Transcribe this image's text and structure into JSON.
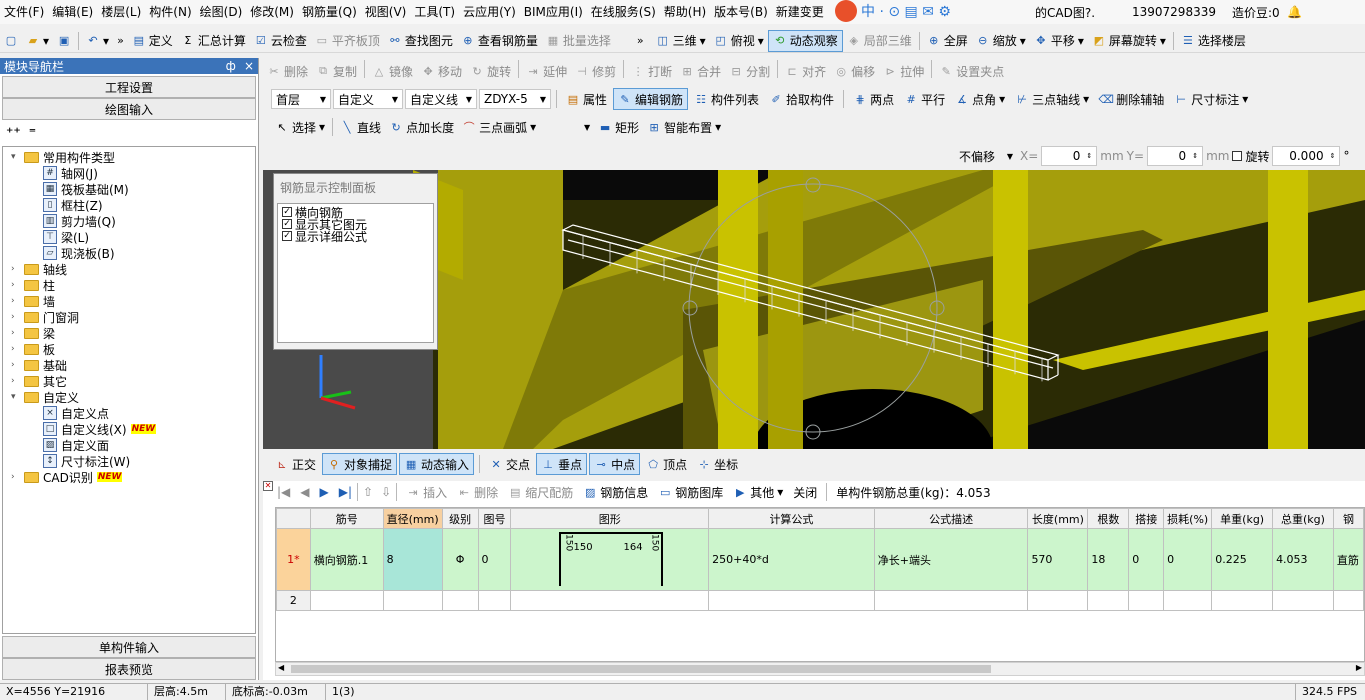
{
  "menu": [
    "文件(F)",
    "编辑(E)",
    "楼层(L)",
    "构件(N)",
    "绘图(D)",
    "修改(M)",
    "钢筋量(Q)",
    "视图(V)",
    "工具(T)",
    "云应用(Y)",
    "BIM应用(I)",
    "在线服务(S)",
    "帮助(H)",
    "版本号(B)",
    "新建变更"
  ],
  "menu_right": {
    "cad": "的CAD图?.",
    "phone": "13907298339",
    "price": "造价豆:0"
  },
  "tb1": {
    "define": "定义",
    "sum": "汇总计算",
    "cloud_check": "云检查",
    "flat_top": "平齐板顶",
    "find": "查找图元",
    "view_rebar": "查看钢筋量",
    "batch_select": "批量选择",
    "three_d": "三维",
    "top_view": "俯视",
    "dynamic": "动态观察",
    "local_3d": "局部三维",
    "full_screen": "全屏",
    "zoom": "缩放",
    "pan": "平移",
    "rotate_screen": "屏幕旋转",
    "select_floor": "选择楼层"
  },
  "tb2": [
    "删除",
    "复制",
    "镜像",
    "移动",
    "旋转",
    "延伸",
    "修剪",
    "打断",
    "合并",
    "分割",
    "对齐",
    "偏移",
    "拉伸",
    "设置夹点"
  ],
  "tb3": {
    "floor": "首层",
    "type": "自定义",
    "sub": "自定义线",
    "name": "ZDYX-5",
    "attr": "属性",
    "edit_rebar": "编辑钢筋",
    "list": "构件列表",
    "pick": "拾取构件",
    "two_point": "两点",
    "parallel": "平行",
    "point_angle": "点角",
    "three_axis": "三点轴线",
    "del_aux": "删除辅轴",
    "dim": "尺寸标注"
  },
  "tb4": {
    "select": "选择",
    "line": "直线",
    "point_len": "点加长度",
    "arc": "三点画弧",
    "rect": "矩形",
    "smart": "智能布置"
  },
  "coord": {
    "offset": "不偏移",
    "x_label": "X=",
    "x": "0",
    "mm1": "mm",
    "y_label": "Y=",
    "y": "0",
    "mm2": "mm",
    "rotate": "旋转",
    "angle": "0.000",
    "deg": "°"
  },
  "left": {
    "title": "模块导航栏",
    "pin": "ф",
    "close": "×",
    "btn1": "工程设置",
    "btn2": "绘图输入",
    "btn3": "单构件输入",
    "btn4": "报表预览"
  },
  "tree": [
    {
      "t": "常用构件类型",
      "lv": 0,
      "f": 1,
      "e": "-"
    },
    {
      "t": "轴网(J)",
      "lv": 1,
      "i": "#"
    },
    {
      "t": "筏板基础(M)",
      "lv": 1,
      "i": "▦"
    },
    {
      "t": "框柱(Z)",
      "lv": 1,
      "i": "▯"
    },
    {
      "t": "剪力墙(Q)",
      "lv": 1,
      "i": "▥"
    },
    {
      "t": "梁(L)",
      "lv": 1,
      "i": "⊤"
    },
    {
      "t": "现浇板(B)",
      "lv": 1,
      "i": "▱"
    },
    {
      "t": "轴线",
      "lv": 0,
      "f": 1,
      "e": "+"
    },
    {
      "t": "柱",
      "lv": 0,
      "f": 1,
      "e": "+"
    },
    {
      "t": "墙",
      "lv": 0,
      "f": 1,
      "e": "+"
    },
    {
      "t": "门窗洞",
      "lv": 0,
      "f": 1,
      "e": "+"
    },
    {
      "t": "梁",
      "lv": 0,
      "f": 1,
      "e": "+"
    },
    {
      "t": "板",
      "lv": 0,
      "f": 1,
      "e": "+"
    },
    {
      "t": "基础",
      "lv": 0,
      "f": 1,
      "e": "+"
    },
    {
      "t": "其它",
      "lv": 0,
      "f": 1,
      "e": "+"
    },
    {
      "t": "自定义",
      "lv": 0,
      "f": 1,
      "e": "-"
    },
    {
      "t": "自定义点",
      "lv": 1,
      "i": "×"
    },
    {
      "t": "自定义线(X)",
      "lv": 1,
      "i": "□",
      "n": 1
    },
    {
      "t": "自定义面",
      "lv": 1,
      "i": "▨"
    },
    {
      "t": "尺寸标注(W)",
      "lv": 1,
      "i": "↕"
    },
    {
      "t": "CAD识别",
      "lv": 0,
      "f": 1,
      "e": "+",
      "n": 1
    }
  ],
  "new_badge": "NEW",
  "panel": {
    "title": "钢筋显示控制面板",
    "items": [
      "横向钢筋",
      "显示其它图元",
      "显示详细公式"
    ]
  },
  "snap": {
    "ortho": "正交",
    "snap": "对象捕捉",
    "dyn": "动态输入",
    "cross": "交点",
    "perp": "垂点",
    "mid": "中点",
    "vertex": "顶点",
    "coord": "坐标"
  },
  "gtb": {
    "insert": "插入",
    "delete": "删除",
    "scale": "缩尺配筋",
    "info": "钢筋信息",
    "lib": "钢筋图库",
    "other": "其他",
    "close": "关闭",
    "total": "单构件钢筋总重(kg)：4.053"
  },
  "headers": [
    "筋号",
    "直径(mm)",
    "级别",
    "图号",
    "图形",
    "计算公式",
    "公式描述",
    "长度(mm)",
    "根数",
    "搭接",
    "损耗(%)",
    "单重(kg)",
    "总重(kg)",
    "钢"
  ],
  "rows": [
    {
      "no": "1*",
      "name": "横向钢筋.1",
      "dia": "8",
      "grade": "Φ",
      "fig": "0",
      "shape_a": "150",
      "shape_b": "164",
      "shape_c": "150",
      "shape_d": "150",
      "formula": "250+40*d",
      "desc": "净长+端头",
      "len": "570",
      "count": "18",
      "lap": "0",
      "loss": "0",
      "unit": "0.225",
      "total": "4.053",
      "last": "直筋"
    },
    {
      "no": "2"
    }
  ],
  "status": {
    "xy": "X=4556 Y=21916",
    "floor_h": "层高:4.5m",
    "base_h": "底标高:-0.03m",
    "sel": "1(3)",
    "fps": "324.5 FPS"
  }
}
